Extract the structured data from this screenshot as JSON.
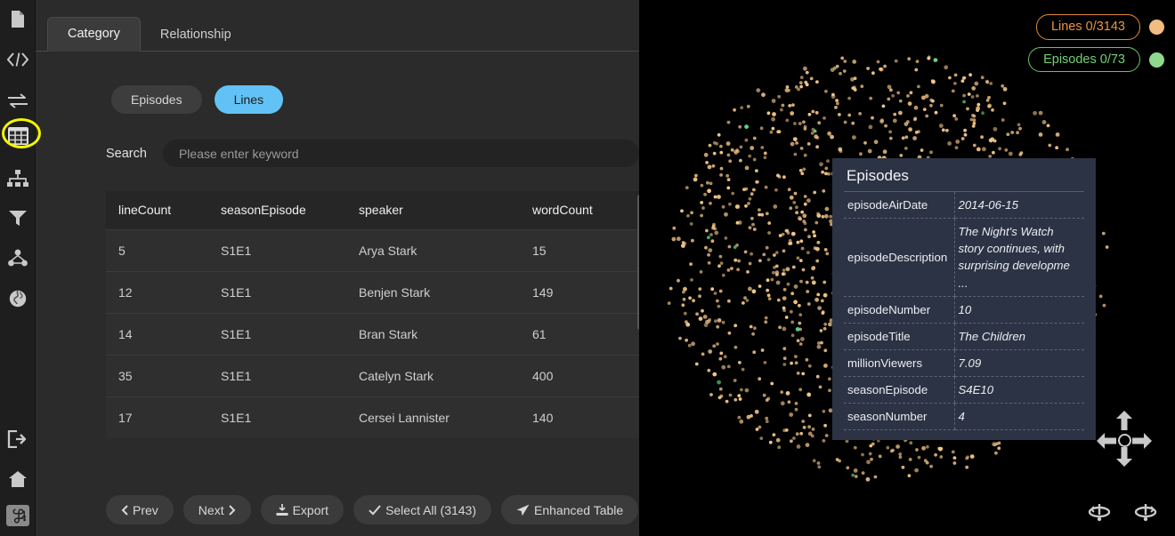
{
  "sidebar": {
    "items": [
      {
        "name": "document-icon",
        "label": "Document"
      },
      {
        "name": "code-icon",
        "label": "Code"
      },
      {
        "name": "exchange-icon",
        "label": "Exchange"
      },
      {
        "name": "table-grid-icon",
        "label": "Table"
      },
      {
        "name": "hierarchy-icon",
        "label": "Hierarchy"
      },
      {
        "name": "filter-icon",
        "label": "Filter"
      },
      {
        "name": "network-icon",
        "label": "Network"
      },
      {
        "name": "globe-icon",
        "label": "Globe"
      },
      {
        "name": "logout-icon",
        "label": "Logout"
      },
      {
        "name": "home-icon",
        "label": "Home"
      },
      {
        "name": "command-icon",
        "label": "Command"
      }
    ],
    "active_item": "table-grid-icon",
    "highlight_color": "#f5f500"
  },
  "tabs": [
    {
      "label": "Category",
      "active": true
    },
    {
      "label": "Relationship",
      "active": false
    }
  ],
  "category_pills": [
    {
      "label": "Episodes",
      "selected": false
    },
    {
      "label": "Lines",
      "selected": true
    }
  ],
  "accent_color": "#62c2f5",
  "search": {
    "label": "Search",
    "placeholder": "Please enter keyword",
    "value": ""
  },
  "table": {
    "columns": [
      "lineCount",
      "seasonEpisode",
      "speaker",
      "wordCount"
    ],
    "rows": [
      [
        "5",
        "S1E1",
        "Arya Stark",
        "15"
      ],
      [
        "12",
        "S1E1",
        "Benjen Stark",
        "149"
      ],
      [
        "14",
        "S1E1",
        "Bran Stark",
        "61"
      ],
      [
        "35",
        "S1E1",
        "Catelyn Stark",
        "400"
      ],
      [
        "17",
        "S1E1",
        "Cersei Lannister",
        "140"
      ]
    ]
  },
  "footer_buttons": [
    {
      "name": "prev-button",
      "label": "Prev",
      "icon": "chevron-left-icon"
    },
    {
      "name": "next-button",
      "label": "Next",
      "icon": "chevron-right-icon"
    },
    {
      "name": "export-button",
      "label": "Export",
      "icon": "download-icon"
    },
    {
      "name": "select-all-button",
      "label": "Select All (3143)",
      "icon": "check-icon"
    },
    {
      "name": "enhanced-table-button",
      "label": "Enhanced Table",
      "icon": "send-icon"
    }
  ],
  "graph": {
    "legend": [
      {
        "label": "Lines 0/3143",
        "color": "#e8963f",
        "dot": "#f3bd7f"
      },
      {
        "label": "Episodes 0/73",
        "color": "#72d174",
        "dot": "#8fd98f"
      }
    ],
    "particle_color": "#f5c88a",
    "particle_accent_color": "#5fd98a",
    "background": "#000000"
  },
  "tooltip": {
    "title": "Episodes",
    "fields": [
      {
        "key": "episodeAirDate",
        "value": "2014-06-15"
      },
      {
        "key": "episodeDescription",
        "value": "The Night's Watch story continues, with surprising developme ..."
      },
      {
        "key": "episodeNumber",
        "value": "10"
      },
      {
        "key": "episodeTitle",
        "value": "The Children"
      },
      {
        "key": "millionViewers",
        "value": "7.09"
      },
      {
        "key": "seasonEpisode",
        "value": "S4E10"
      },
      {
        "key": "seasonNumber",
        "value": "4"
      }
    ]
  },
  "nav_controls": {
    "pan_up": "pan-up-arrow",
    "pan_down": "pan-down-arrow",
    "pan_left": "pan-left-arrow",
    "pan_right": "pan-right-arrow",
    "center": "recenter-button",
    "rotate_left": "rotate-left-button",
    "rotate_right": "rotate-right-button"
  }
}
